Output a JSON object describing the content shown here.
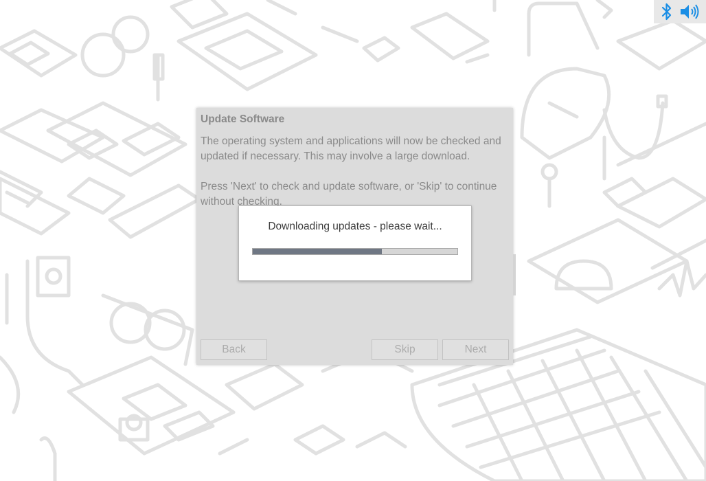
{
  "tray": {
    "bluetooth_icon": "bluetooth-icon",
    "volume_icon": "volume-icon",
    "accent_color": "#1a8ee5"
  },
  "wizard": {
    "title": "Update Software",
    "paragraph1": "The operating system and applications will now be checked and updated if necessary. This may involve a large download.",
    "paragraph2": "Press 'Next' to check and update software, or 'Skip' to continue without checking.",
    "back_label": "Back",
    "skip_label": "Skip",
    "next_label": "Next"
  },
  "progress_dialog": {
    "message": "Downloading updates - please wait...",
    "progress_fraction": 0.63
  }
}
